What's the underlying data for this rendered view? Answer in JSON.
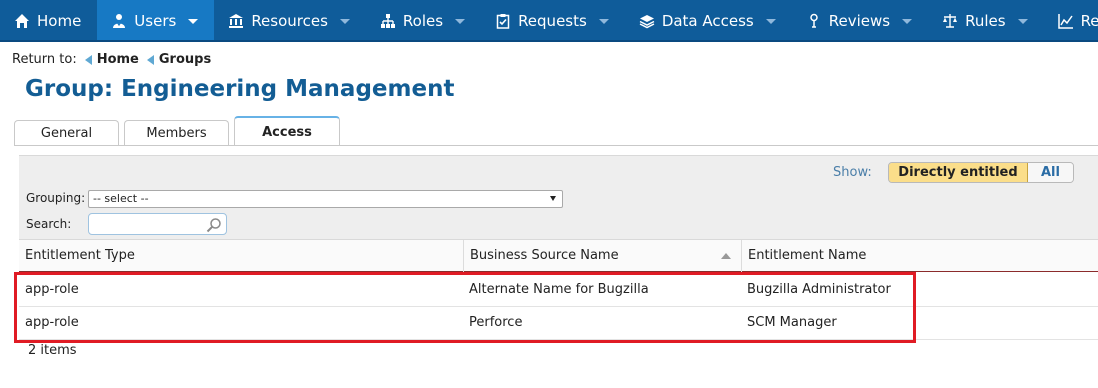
{
  "nav": {
    "items": [
      {
        "label": "Home",
        "icon": "home-icon",
        "has_menu": false,
        "active": false
      },
      {
        "label": "Users",
        "icon": "users-icon",
        "has_menu": true,
        "active": true
      },
      {
        "label": "Resources",
        "icon": "bank-icon",
        "has_menu": true,
        "active": false
      },
      {
        "label": "Roles",
        "icon": "sitemap-icon",
        "has_menu": true,
        "active": false
      },
      {
        "label": "Requests",
        "icon": "clipboard-check-icon",
        "has_menu": true,
        "active": false
      },
      {
        "label": "Data Access",
        "icon": "layers-icon",
        "has_menu": true,
        "active": false
      },
      {
        "label": "Reviews",
        "icon": "person-pin-icon",
        "has_menu": true,
        "active": false
      },
      {
        "label": "Rules",
        "icon": "scales-icon",
        "has_menu": true,
        "active": false
      },
      {
        "label": "Rep",
        "icon": "chart-icon",
        "has_menu": false,
        "active": false
      }
    ]
  },
  "breadcrumb": {
    "prefix": "Return to:",
    "links": [
      "Home",
      "Groups"
    ]
  },
  "page": {
    "title": "Group: Engineering Management"
  },
  "tabs": [
    {
      "label": "General",
      "active": false
    },
    {
      "label": "Members",
      "active": false
    },
    {
      "label": "Access",
      "active": true
    }
  ],
  "filter": {
    "show_label": "Show:",
    "show_options": [
      "Directly entitled",
      "All"
    ],
    "show_selected": "Directly entitled",
    "grouping_label": "Grouping:",
    "grouping_value": "-- select --",
    "search_label": "Search:",
    "search_value": ""
  },
  "table": {
    "columns": [
      "Entitlement Type",
      "Business Source Name",
      "Entitlement Name"
    ],
    "sorted_column": "Business Source Name",
    "sort_direction": "ascending",
    "rows": [
      [
        "app-role",
        "Alternate Name for Bugzilla",
        "Bugzilla Administrator"
      ],
      [
        "app-role",
        "Perforce",
        "SCM Manager"
      ]
    ],
    "item_count": "2 items"
  },
  "colors": {
    "nav_bg": "#0f5c9a",
    "nav_active": "#1779c4",
    "title": "#135d94",
    "toggle_on": "#fbde8a",
    "highlight_box": "#e01b24"
  }
}
